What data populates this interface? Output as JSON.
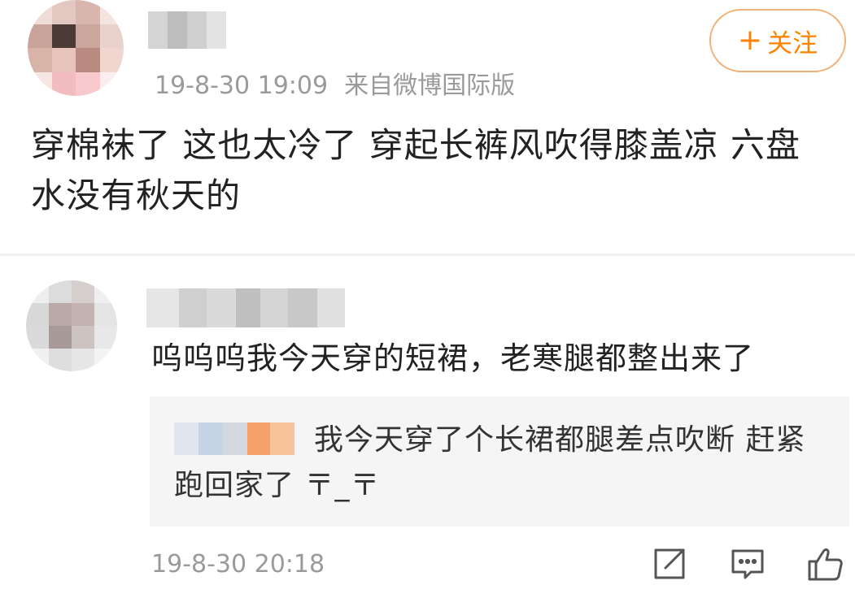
{
  "post": {
    "timestamp": "19-8-30 19:09",
    "source": "来自微博国际版",
    "follow_label": "关注",
    "follow_plus": "+",
    "text": "穿棉袜了 这也太冷了 穿起长裤风吹得膝盖凉 六盘水没有秋天的"
  },
  "comment": {
    "text": "呜呜呜我今天穿的短裙，老寒腿都整出来了",
    "reply_text": "我今天穿了个长裙都腿差点吹断 赶紧跑回家了 〒_〒",
    "timestamp": "19-8-30 20:18"
  },
  "icons": {
    "share": "share-icon",
    "reply": "comment-icon",
    "like": "thumbs-up-icon"
  },
  "colors": {
    "accent": "#ff8200",
    "follow_border": "#f0b27a",
    "meta_gray": "#9a9a9a",
    "reply_bg": "#f5f5f5"
  }
}
